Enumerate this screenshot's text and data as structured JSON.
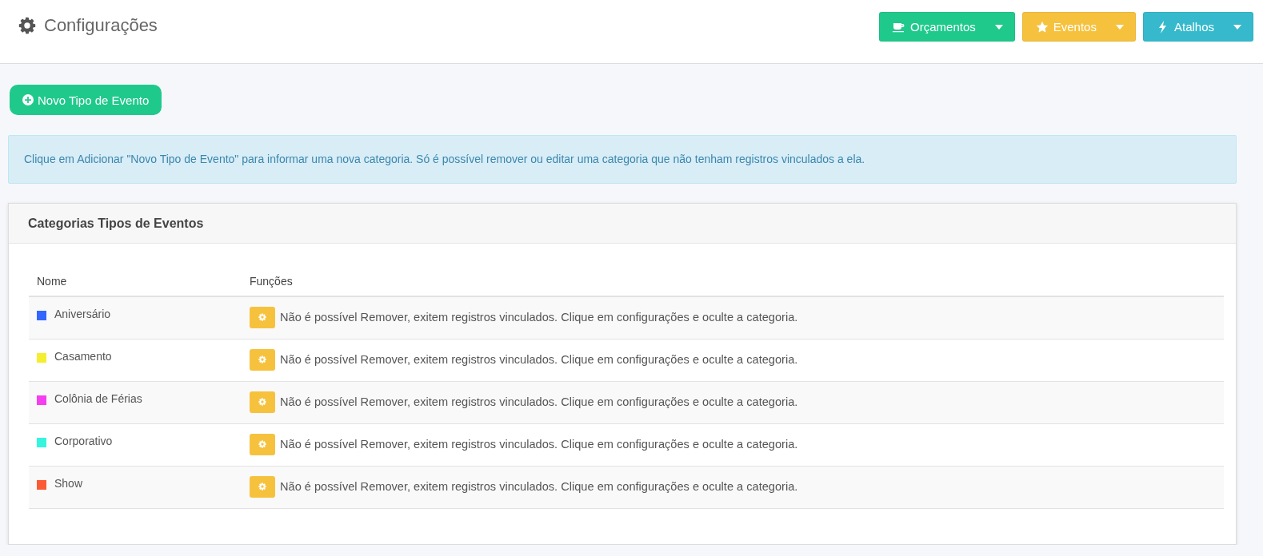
{
  "header": {
    "title": "Configurações",
    "buttons": [
      {
        "label": "Orçamentos",
        "kind": "cup",
        "color": "#1fc98c"
      },
      {
        "label": "Eventos",
        "kind": "star",
        "color": "#f6c23e"
      },
      {
        "label": "Atalhos",
        "kind": "bolt",
        "color": "#36b9cc"
      }
    ]
  },
  "new_button": {
    "label": "Novo Tipo de Evento"
  },
  "alert": {
    "text": "Clique em Adicionar \"Novo Tipo de Evento\" para informar uma nova categoria. Só é possível remover ou editar uma categoria que não tenham registros vinculados a ela."
  },
  "card": {
    "title": "Categorias Tipos de Eventos",
    "table": {
      "columns": [
        "Nome",
        "Funções"
      ],
      "rows": [
        {
          "name": "Aniversário",
          "color": "#3366ff",
          "message": "Não é possível Remover, exitem registros vinculados. Clique em configurações e oculte a categoria."
        },
        {
          "name": "Casamento",
          "color": "#f5ee2e",
          "message": "Não é possível Remover, exitem registros vinculados. Clique em configurações e oculte a categoria."
        },
        {
          "name": "Colônia de Férias",
          "color": "#f53ef0",
          "message": "Não é possível Remover, exitem registros vinculados. Clique em configurações e oculte a categoria."
        },
        {
          "name": "Corporativo",
          "color": "#36f5de",
          "message": "Não é possível Remover, exitem registros vinculados. Clique em configurações e oculte a categoria."
        },
        {
          "name": "Show",
          "color": "#fa5b35",
          "message": "Não é possível Remover, exitem registros vinculados. Clique em configurações e oculte a categoria."
        }
      ]
    }
  }
}
